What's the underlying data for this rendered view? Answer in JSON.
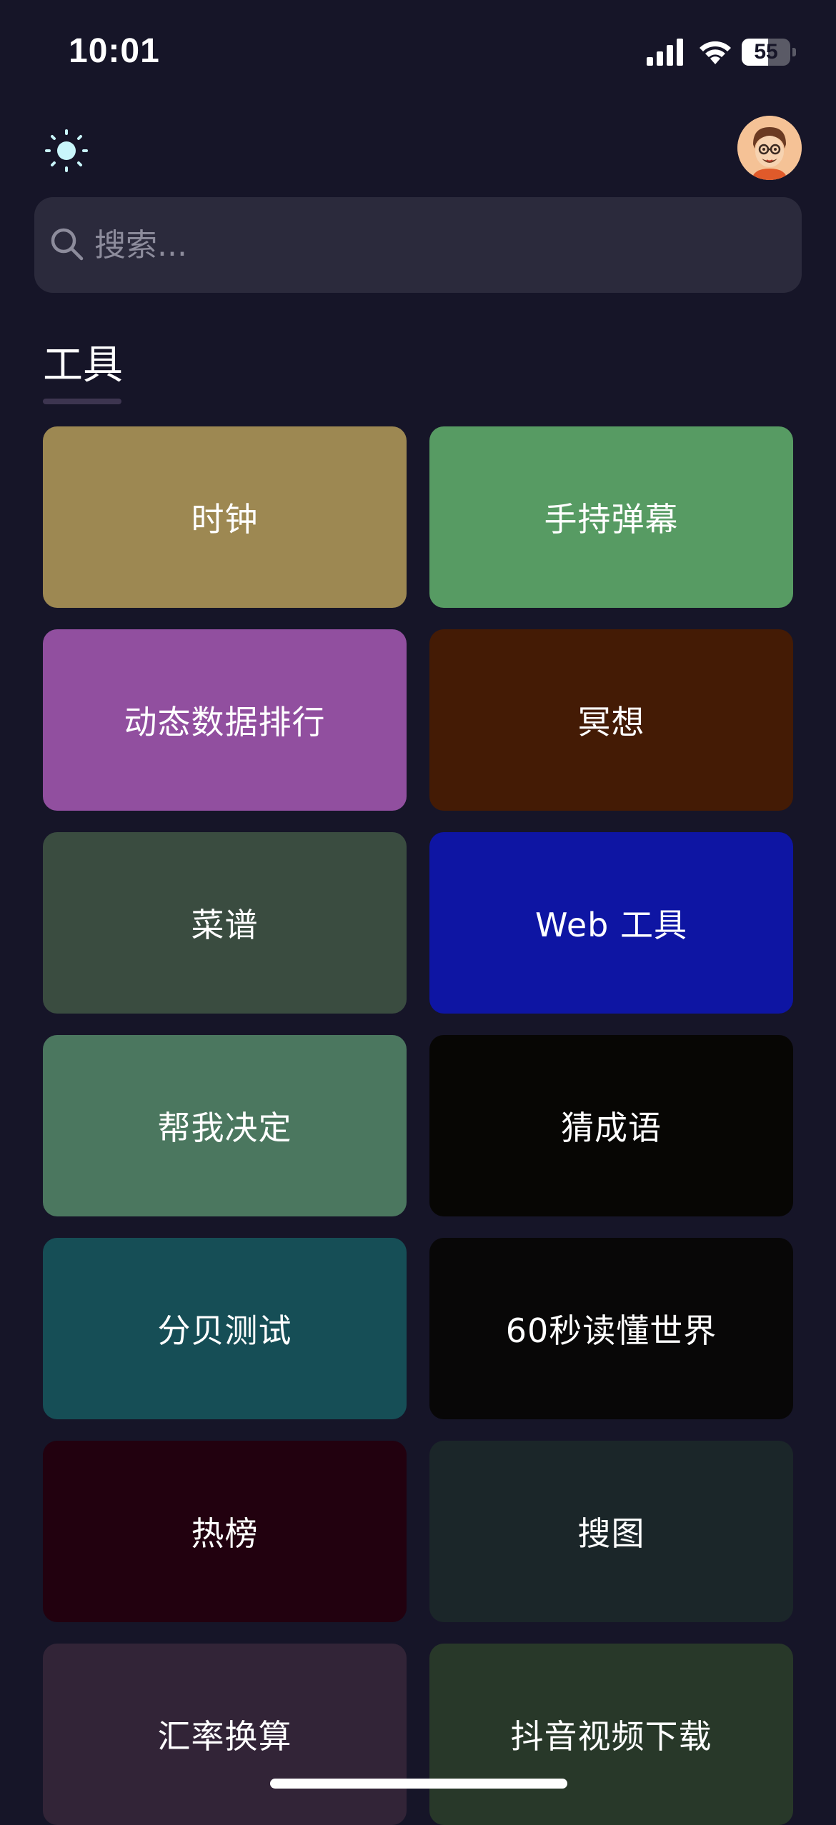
{
  "status_bar": {
    "time": "10:01",
    "battery_level": "55",
    "battery_fraction": 0.55,
    "icons": [
      "signal-icon",
      "wifi-icon",
      "battery-icon"
    ]
  },
  "header": {
    "theme_icon": "sun-icon",
    "avatar_icon": "avatar"
  },
  "search": {
    "placeholder": "搜索...",
    "value": "",
    "icon": "search-icon"
  },
  "section": {
    "title": "工具"
  },
  "tools": [
    {
      "label": "时钟",
      "color": "#9d8852"
    },
    {
      "label": "手持弹幕",
      "color": "#579b63"
    },
    {
      "label": "动态数据排行",
      "color": "#914f9f"
    },
    {
      "label": "冥想",
      "color": "#441b05"
    },
    {
      "label": "菜谱",
      "color": "#3a4c40"
    },
    {
      "label": "Web 工具",
      "color": "#0e15a3"
    },
    {
      "label": "帮我决定",
      "color": "#4b775f"
    },
    {
      "label": "猜成语",
      "color": "#070604"
    },
    {
      "label": "分贝测试",
      "color": "#164e56"
    },
    {
      "label": "60秒读懂世界",
      "color": "#080707"
    },
    {
      "label": "热榜",
      "color": "#22010f"
    },
    {
      "label": "搜图",
      "color": "#1b2629"
    },
    {
      "label": "汇率换算",
      "color": "#322437"
    },
    {
      "label": "抖音视频下载",
      "color": "#283829"
    }
  ],
  "colors": {
    "background": "#161528",
    "search_background": "#2b2a3c",
    "placeholder": "#8d8c9c",
    "underline": "#3d3550",
    "sun": "#c9f6fb"
  }
}
